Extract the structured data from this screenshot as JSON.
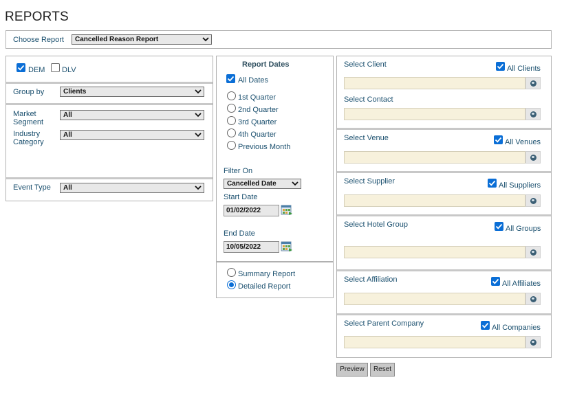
{
  "page": {
    "title": "REPORTS"
  },
  "choose_report": {
    "label": "Choose Report",
    "value": "Cancelled Reason Report"
  },
  "left": {
    "dem_label": "DEM",
    "dem_checked": true,
    "dlv_label": "DLV",
    "dlv_checked": false,
    "group_by": {
      "label": "Group by",
      "value": "Clients"
    },
    "market_segment": {
      "label_line1": "Market",
      "label_line2": "Segment",
      "value": "All"
    },
    "industry_category": {
      "label_line1": "Industry",
      "label_line2": "Category",
      "value": "All"
    },
    "event_type": {
      "label": "Event Type",
      "value": "All"
    }
  },
  "dates": {
    "heading": "Report Dates",
    "all_dates": {
      "label": "All Dates",
      "checked": true
    },
    "options": [
      "1st Quarter",
      "2nd Quarter",
      "3rd Quarter",
      "4th Quarter",
      "Previous Month"
    ],
    "filter_on": {
      "label": "Filter On",
      "value": "Cancelled Date"
    },
    "start_date": {
      "label": "Start Date",
      "value": "01/02/2022"
    },
    "end_date": {
      "label": "End Date",
      "value": "10/05/2022"
    }
  },
  "report_type": {
    "summary": {
      "label": "Summary Report",
      "selected": false
    },
    "detailed": {
      "label": "Detailed Report",
      "selected": true
    }
  },
  "selectors": {
    "client": {
      "label": "Select Client",
      "all_label": "All Clients",
      "checked": true
    },
    "contact": {
      "label": "Select Contact"
    },
    "venue": {
      "label": "Select Venue",
      "all_label": "All Venues",
      "checked": true
    },
    "supplier": {
      "label": "Select Supplier",
      "all_label": "All Suppliers",
      "checked": true
    },
    "hotel_group": {
      "label": "Select Hotel Group",
      "all_label": "All Groups",
      "checked": true
    },
    "affiliation": {
      "label": "Select Affiliation",
      "all_label": "All Affiliates",
      "checked": true
    },
    "parent_company": {
      "label": "Select Parent Company",
      "all_label": "All Companies",
      "checked": true
    }
  },
  "buttons": {
    "preview": "Preview",
    "reset": "Reset"
  },
  "icons": {
    "checkbox": "check-icon",
    "dropdown": "chevron-down-icon",
    "lookup": "globe-icon",
    "calendar": "calendar-icon"
  },
  "colors": {
    "label": "#1a4f6e",
    "input_bg": "#f7f1dc",
    "checkbox": "#0a6ed6"
  }
}
